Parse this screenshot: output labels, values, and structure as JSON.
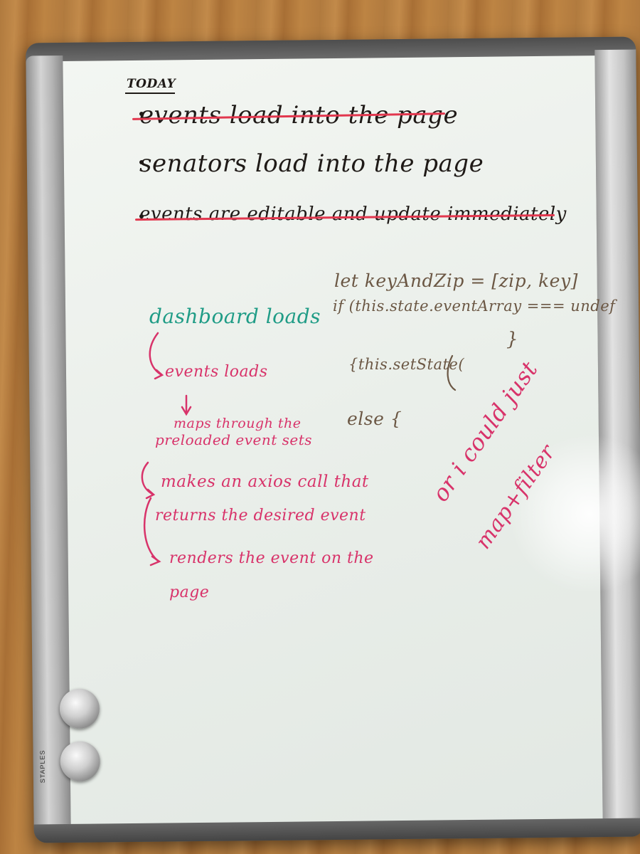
{
  "whiteboard": {
    "brand": "STAPLES",
    "todo_title": "TODAY",
    "todo_items": [
      {
        "text": "events load into the page",
        "done": true
      },
      {
        "text": "senators load into the page",
        "done": false
      },
      {
        "text": "events are editable and update immediately",
        "done": true
      }
    ],
    "flow": {
      "start": "dashboard loads",
      "steps": [
        "events loads",
        "maps through the",
        "preloaded event sets",
        "makes an axios call that",
        "returns the desired event",
        "renders the event on the",
        "page"
      ]
    },
    "code_lines": [
      "let keyAndZip = [zip, key]",
      "if (this.state.eventArray === undef",
      "{this.setState(",
      "}",
      "else {"
    ],
    "side_note": [
      "or i could just",
      "map+filter"
    ],
    "colors": {
      "black_marker": "#1f1a17",
      "brown_marker": "#6b5744",
      "pink_marker": "#d8336a",
      "teal_marker": "#1f9c86",
      "strike_red": "#e2374e"
    }
  }
}
